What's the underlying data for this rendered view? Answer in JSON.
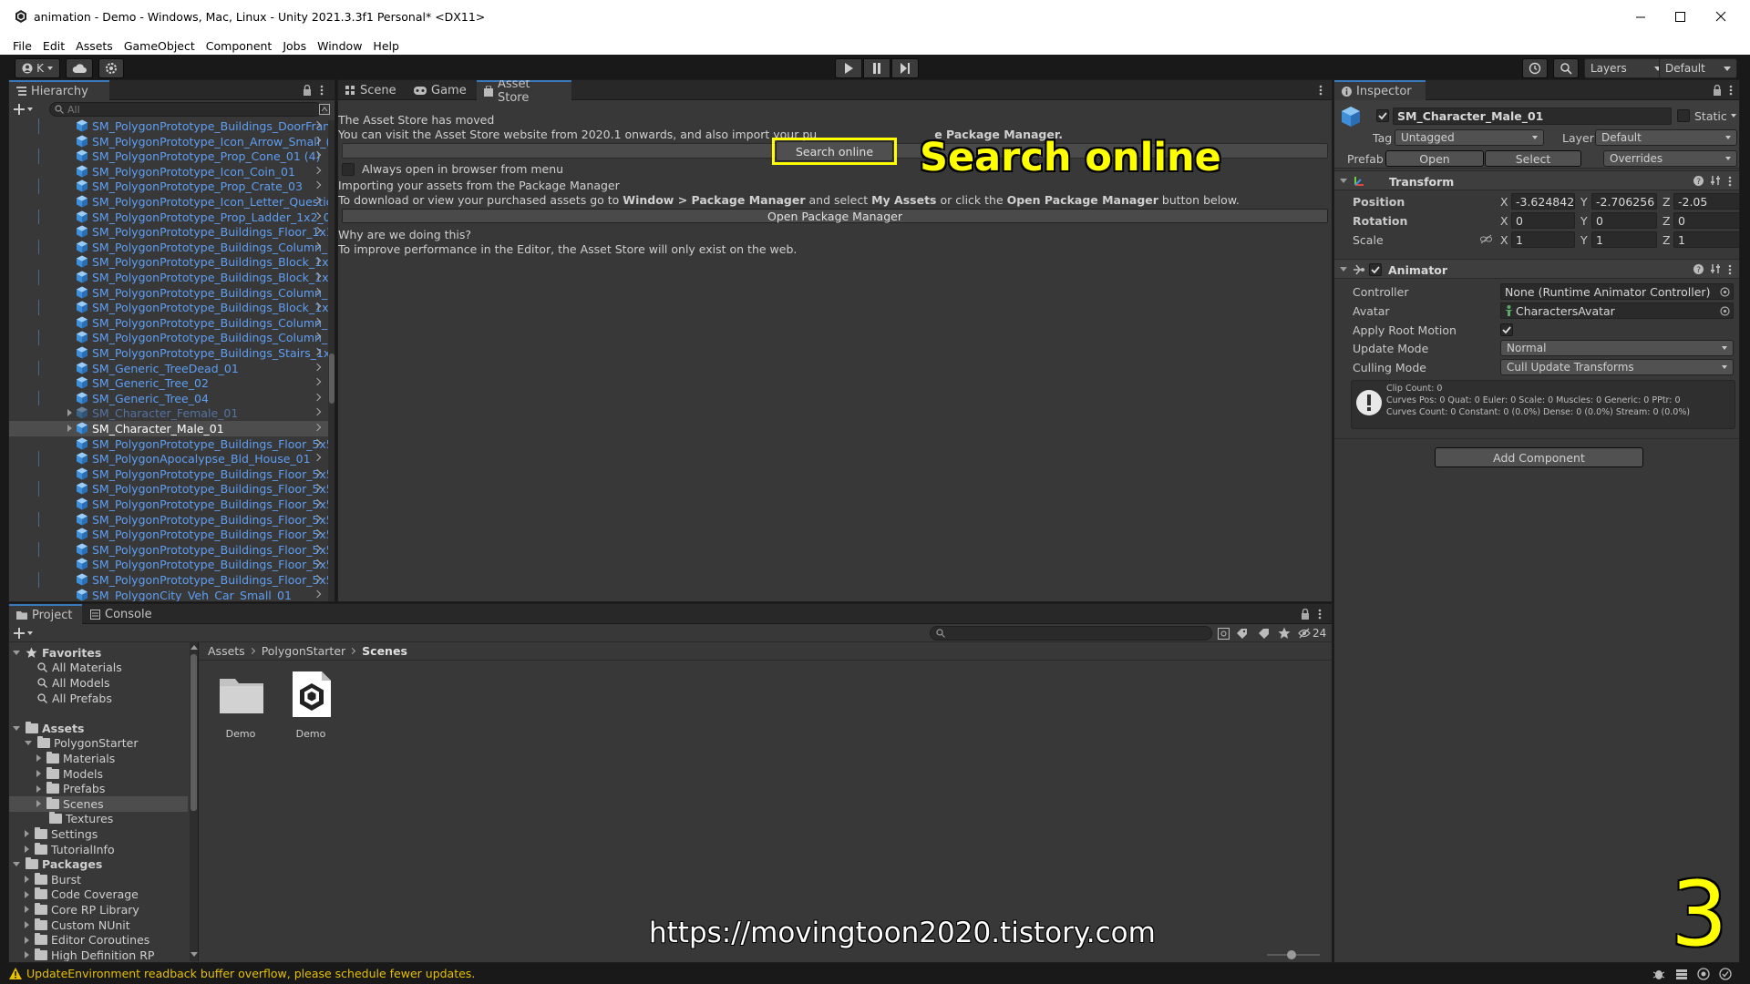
{
  "window": {
    "title": "animation - Demo - Windows, Mac, Linux - Unity 2021.3.3f1 Personal* <DX11>"
  },
  "menu": [
    "File",
    "Edit",
    "Assets",
    "GameObject",
    "Component",
    "Jobs",
    "Window",
    "Help"
  ],
  "toolbar": {
    "account_initial": "K",
    "layers_label": "Layers",
    "layout_label": "Default"
  },
  "hierarchy": {
    "tab_label": "Hierarchy",
    "search_placeholder": "All",
    "items": [
      {
        "label": "SM_PolygonPrototype_Buildings_DoorFran",
        "state": "normal"
      },
      {
        "label": "SM_PolygonPrototype_Icon_Arrow_Small_(",
        "state": "normal"
      },
      {
        "label": "SM_PolygonPrototype_Prop_Cone_01 (4)",
        "state": "normal"
      },
      {
        "label": "SM_PolygonPrototype_Icon_Coin_01",
        "state": "normal"
      },
      {
        "label": "SM_PolygonPrototype_Prop_Crate_03",
        "state": "normal"
      },
      {
        "label": "SM_PolygonPrototype_Icon_Letter_Questic",
        "state": "normal"
      },
      {
        "label": "SM_PolygonPrototype_Prop_Ladder_1x2_0",
        "state": "normal"
      },
      {
        "label": "SM_PolygonPrototype_Buildings_Floor_1x1",
        "state": "normal"
      },
      {
        "label": "SM_PolygonPrototype_Buildings_Column_:",
        "state": "normal"
      },
      {
        "label": "SM_PolygonPrototype_Buildings_Block_1x",
        "state": "normal"
      },
      {
        "label": "SM_PolygonPrototype_Buildings_Block_1x",
        "state": "normal"
      },
      {
        "label": "SM_PolygonPrototype_Buildings_Column_:",
        "state": "normal"
      },
      {
        "label": "SM_PolygonPrototype_Buildings_Block_1x",
        "state": "normal"
      },
      {
        "label": "SM_PolygonPrototype_Buildings_Column_:",
        "state": "normal"
      },
      {
        "label": "SM_PolygonPrototype_Buildings_Column_:",
        "state": "normal"
      },
      {
        "label": "SM_PolygonPrototype_Buildings_Stairs_1x",
        "state": "normal"
      },
      {
        "label": "SM_Generic_TreeDead_01",
        "state": "normal"
      },
      {
        "label": "SM_Generic_Tree_02",
        "state": "normal"
      },
      {
        "label": "SM_Generic_Tree_04",
        "state": "normal"
      },
      {
        "label": "SM_Character_Female_01",
        "state": "disabled"
      },
      {
        "label": "SM_Character_Male_01",
        "state": "selected"
      },
      {
        "label": "SM_PolygonPrototype_Buildings_Floor_5x5",
        "state": "normal"
      },
      {
        "label": "SM_PolygonApocalypse_Bld_House_01",
        "state": "normal"
      },
      {
        "label": "SM_PolygonPrototype_Buildings_Floor_5x5",
        "state": "normal"
      },
      {
        "label": "SM_PolygonPrototype_Buildings_Floor_5x5",
        "state": "normal"
      },
      {
        "label": "SM_PolygonPrototype_Buildings_Floor_5x5",
        "state": "normal"
      },
      {
        "label": "SM_PolygonPrototype_Buildings_Floor_5x5",
        "state": "normal"
      },
      {
        "label": "SM_PolygonPrototype_Buildings_Floor_5x5",
        "state": "normal"
      },
      {
        "label": "SM_PolygonPrototype_Buildings_Floor_5x5",
        "state": "normal"
      },
      {
        "label": "SM_PolygonPrototype_Buildings_Floor_5x5",
        "state": "normal"
      },
      {
        "label": "SM_PolygonPrototype_Buildings_Floor_5x5",
        "state": "normal"
      },
      {
        "label": "SM_PolygonCity_Veh_Car_Small_01",
        "state": "normal"
      }
    ]
  },
  "center": {
    "tabs": [
      "Scene",
      "Game",
      "Asset Store"
    ],
    "moved_title": "The Asset Store has moved",
    "moved_desc_a": "You can visit the Asset Store website from 2020.1 onwards, and also import your pu",
    "moved_desc_b": "e Package Manager.",
    "search_online_button": "Search online",
    "always_open_label": "Always open in browser from menu",
    "importing_title": "Importing your assets from the Package Manager",
    "importing_desc_1": "To download or view your purchased assets go to ",
    "importing_desc_2": "Window > Package Manager",
    "importing_desc_3": " and select ",
    "importing_desc_4": "My Assets",
    "importing_desc_5": " or click the ",
    "importing_desc_6": "Open Package Manager",
    "importing_desc_7": " button below.",
    "open_pm_button": "Open Package Manager",
    "why_title": "Why are we doing this?",
    "why_desc": "To improve performance in the Editor, the Asset Store will only exist on the web.",
    "callout_text": "Search online"
  },
  "inspector": {
    "tab_label": "Inspector",
    "object_name": "SM_Character_Male_01",
    "static_label": "Static",
    "tag_label": "Tag",
    "tag_value": "Untagged",
    "layer_label": "Layer",
    "layer_value": "Default",
    "prefab_label": "Prefab",
    "prefab_open": "Open",
    "prefab_select": "Select",
    "prefab_overrides": "Overrides",
    "transform": {
      "title": "Transform",
      "position_label": "Position",
      "rotation_label": "Rotation",
      "scale_label": "Scale",
      "pos": {
        "x": "-3.624842",
        "y": "-2.706256",
        "z": "-2.05"
      },
      "rot": {
        "x": "0",
        "y": "0",
        "z": "0"
      },
      "scl": {
        "x": "1",
        "y": "1",
        "z": "1"
      }
    },
    "animator": {
      "title": "Animator",
      "controller_label": "Controller",
      "controller_value": "None (Runtime Animator Controller)",
      "avatar_label": "Avatar",
      "avatar_value": "CharactersAvatar",
      "root_motion_label": "Apply Root Motion",
      "update_mode_label": "Update Mode",
      "update_mode_value": "Normal",
      "culling_label": "Culling Mode",
      "culling_value": "Cull Update Transforms",
      "info_1": "Clip Count: 0",
      "info_2": "Curves Pos: 0 Quat: 0 Euler: 0 Scale: 0 Muscles: 0 Generic: 0 PPtr: 0",
      "info_3": "Curves Count: 0 Constant: 0 (0.0%) Dense: 0 (0.0%) Stream: 0 (0.0%)"
    },
    "add_component": "Add Component"
  },
  "project": {
    "tabs": [
      "Project",
      "Console"
    ],
    "hidden_count": "24",
    "breadcrumb": [
      "Assets",
      "PolygonStarter",
      "Scenes"
    ],
    "tree": [
      {
        "label": "Favorites",
        "indent": 0,
        "kind": "header-fav",
        "arrow": "down"
      },
      {
        "label": "All Materials",
        "indent": 1,
        "kind": "search",
        "arrow": "none"
      },
      {
        "label": "All Models",
        "indent": 1,
        "kind": "search",
        "arrow": "none"
      },
      {
        "label": "All Prefabs",
        "indent": 1,
        "kind": "search",
        "arrow": "none"
      },
      {
        "label": "",
        "indent": 0,
        "kind": "spacer",
        "arrow": "none"
      },
      {
        "label": "Assets",
        "indent": 0,
        "kind": "header",
        "arrow": "down"
      },
      {
        "label": "PolygonStarter",
        "indent": 1,
        "kind": "folder",
        "arrow": "down"
      },
      {
        "label": "Materials",
        "indent": 2,
        "kind": "folder",
        "arrow": "right"
      },
      {
        "label": "Models",
        "indent": 2,
        "kind": "folder",
        "arrow": "right"
      },
      {
        "label": "Prefabs",
        "indent": 2,
        "kind": "folder",
        "arrow": "right"
      },
      {
        "label": "Scenes",
        "indent": 2,
        "kind": "folder",
        "arrow": "right",
        "selected": true
      },
      {
        "label": "Textures",
        "indent": 2,
        "kind": "folder",
        "arrow": "none"
      },
      {
        "label": "Settings",
        "indent": 1,
        "kind": "folder",
        "arrow": "right"
      },
      {
        "label": "TutorialInfo",
        "indent": 1,
        "kind": "folder",
        "arrow": "right"
      },
      {
        "label": "Packages",
        "indent": 0,
        "kind": "header",
        "arrow": "down"
      },
      {
        "label": "Burst",
        "indent": 1,
        "kind": "folder",
        "arrow": "right"
      },
      {
        "label": "Code Coverage",
        "indent": 1,
        "kind": "folder",
        "arrow": "right"
      },
      {
        "label": "Core RP Library",
        "indent": 1,
        "kind": "folder",
        "arrow": "right"
      },
      {
        "label": "Custom NUnit",
        "indent": 1,
        "kind": "folder",
        "arrow": "right"
      },
      {
        "label": "Editor Coroutines",
        "indent": 1,
        "kind": "folder",
        "arrow": "right"
      },
      {
        "label": "High Definition RP",
        "indent": 1,
        "kind": "folder",
        "arrow": "right"
      }
    ],
    "assets": [
      {
        "label": "Demo",
        "kind": "folder"
      },
      {
        "label": "Demo",
        "kind": "scene"
      }
    ],
    "zoom_level": 0.45
  },
  "status": {
    "message": "UpdateEnvironment readback buffer overflow, please schedule fewer updates."
  },
  "overlay": {
    "url": "https://movingtoon2020.tistory.com",
    "step_number": "3"
  },
  "colors": {
    "accent_blue": "#3a79bb",
    "prefab_blue": "#5e9ef2",
    "callout_yellow": "#ffff00",
    "warning": "#e5c000"
  }
}
